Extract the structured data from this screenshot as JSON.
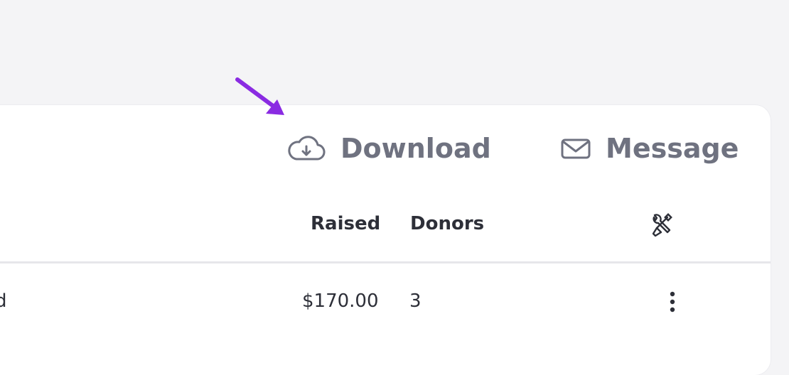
{
  "toolbar": {
    "download_label": "Download",
    "message_label": "Message"
  },
  "table": {
    "columns": [
      "Raised",
      "Donors"
    ],
    "rows": [
      {
        "name_fragment": "d",
        "raised": "$170.00",
        "donors": "3"
      }
    ]
  },
  "icons": {
    "download": "cloud-download-icon",
    "message": "envelope-icon",
    "settings": "tools-icon",
    "row_menu": "kebab-menu-icon",
    "annotation": "arrow-icon"
  },
  "colors": {
    "page_bg": "#f4f4f6",
    "card_bg": "#ffffff",
    "toolbar_text": "#6f7280",
    "table_text": "#2d2f38",
    "annotation_arrow": "#8a2be2",
    "divider": "#e6e6ea"
  }
}
